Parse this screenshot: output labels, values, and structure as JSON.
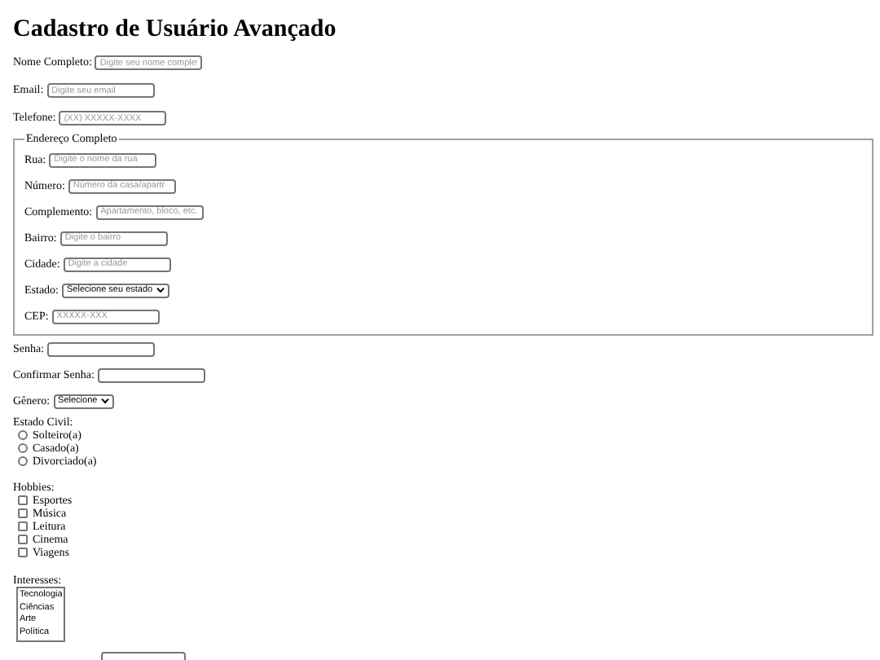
{
  "title": "Cadastro de Usuário Avançado",
  "fields_top": [
    {
      "kind": "text",
      "label": "Nome Completo:",
      "placeholder": "Digite seu nome complet"
    },
    {
      "kind": "text",
      "label": "Email:",
      "placeholder": "Digite seu email"
    },
    {
      "kind": "text",
      "label": "Telefone:",
      "placeholder": "(XX) XXXXX-XXXX"
    }
  ],
  "address": {
    "legend": "Endereço Completo",
    "fields": [
      {
        "kind": "text",
        "label": "Rua:",
        "placeholder": "Digite o nome da rua"
      },
      {
        "kind": "text",
        "label": "Número:",
        "placeholder": "Número da casa/apartr"
      },
      {
        "kind": "text",
        "label": "Complemento:",
        "placeholder": "Apartamento, bloco, etc."
      },
      {
        "kind": "text",
        "label": "Bairro:",
        "placeholder": "Digite o bairro"
      },
      {
        "kind": "text",
        "label": "Cidade:",
        "placeholder": "Digite a cidade"
      },
      {
        "kind": "select",
        "label": "Estado:",
        "value": "Selecione seu estado"
      },
      {
        "kind": "text",
        "label": "CEP:",
        "placeholder": "XXXXX-XXX"
      }
    ]
  },
  "fields_bottom": [
    {
      "kind": "text",
      "label": "Senha:"
    },
    {
      "kind": "text",
      "label": "Confirmar Senha:"
    },
    {
      "kind": "select",
      "label": "Gênero:",
      "value": "Selecione"
    }
  ],
  "marital_status": {
    "label": "Estado Civil:",
    "options": [
      {
        "label": "Solteiro(a)",
        "selected": false
      },
      {
        "label": "Casado(a)",
        "selected": false
      },
      {
        "label": "Divorciado(a)",
        "selected": false
      }
    ]
  },
  "hobbies": {
    "label": "Hobbies:",
    "options": [
      {
        "label": "Esportes",
        "checked": false
      },
      {
        "label": "Música",
        "checked": false
      },
      {
        "label": "Leitura",
        "checked": false
      },
      {
        "label": "Cinema",
        "checked": false
      },
      {
        "label": "Viagens",
        "checked": false
      }
    ]
  },
  "interests": {
    "label": "Interesses:",
    "options": [
      {
        "label": "Tecnologia",
        "selected": false
      },
      {
        "label": "Ciências",
        "selected": false
      },
      {
        "label": "Arte",
        "selected": false
      },
      {
        "label": "Política",
        "selected": false
      }
    ]
  }
}
